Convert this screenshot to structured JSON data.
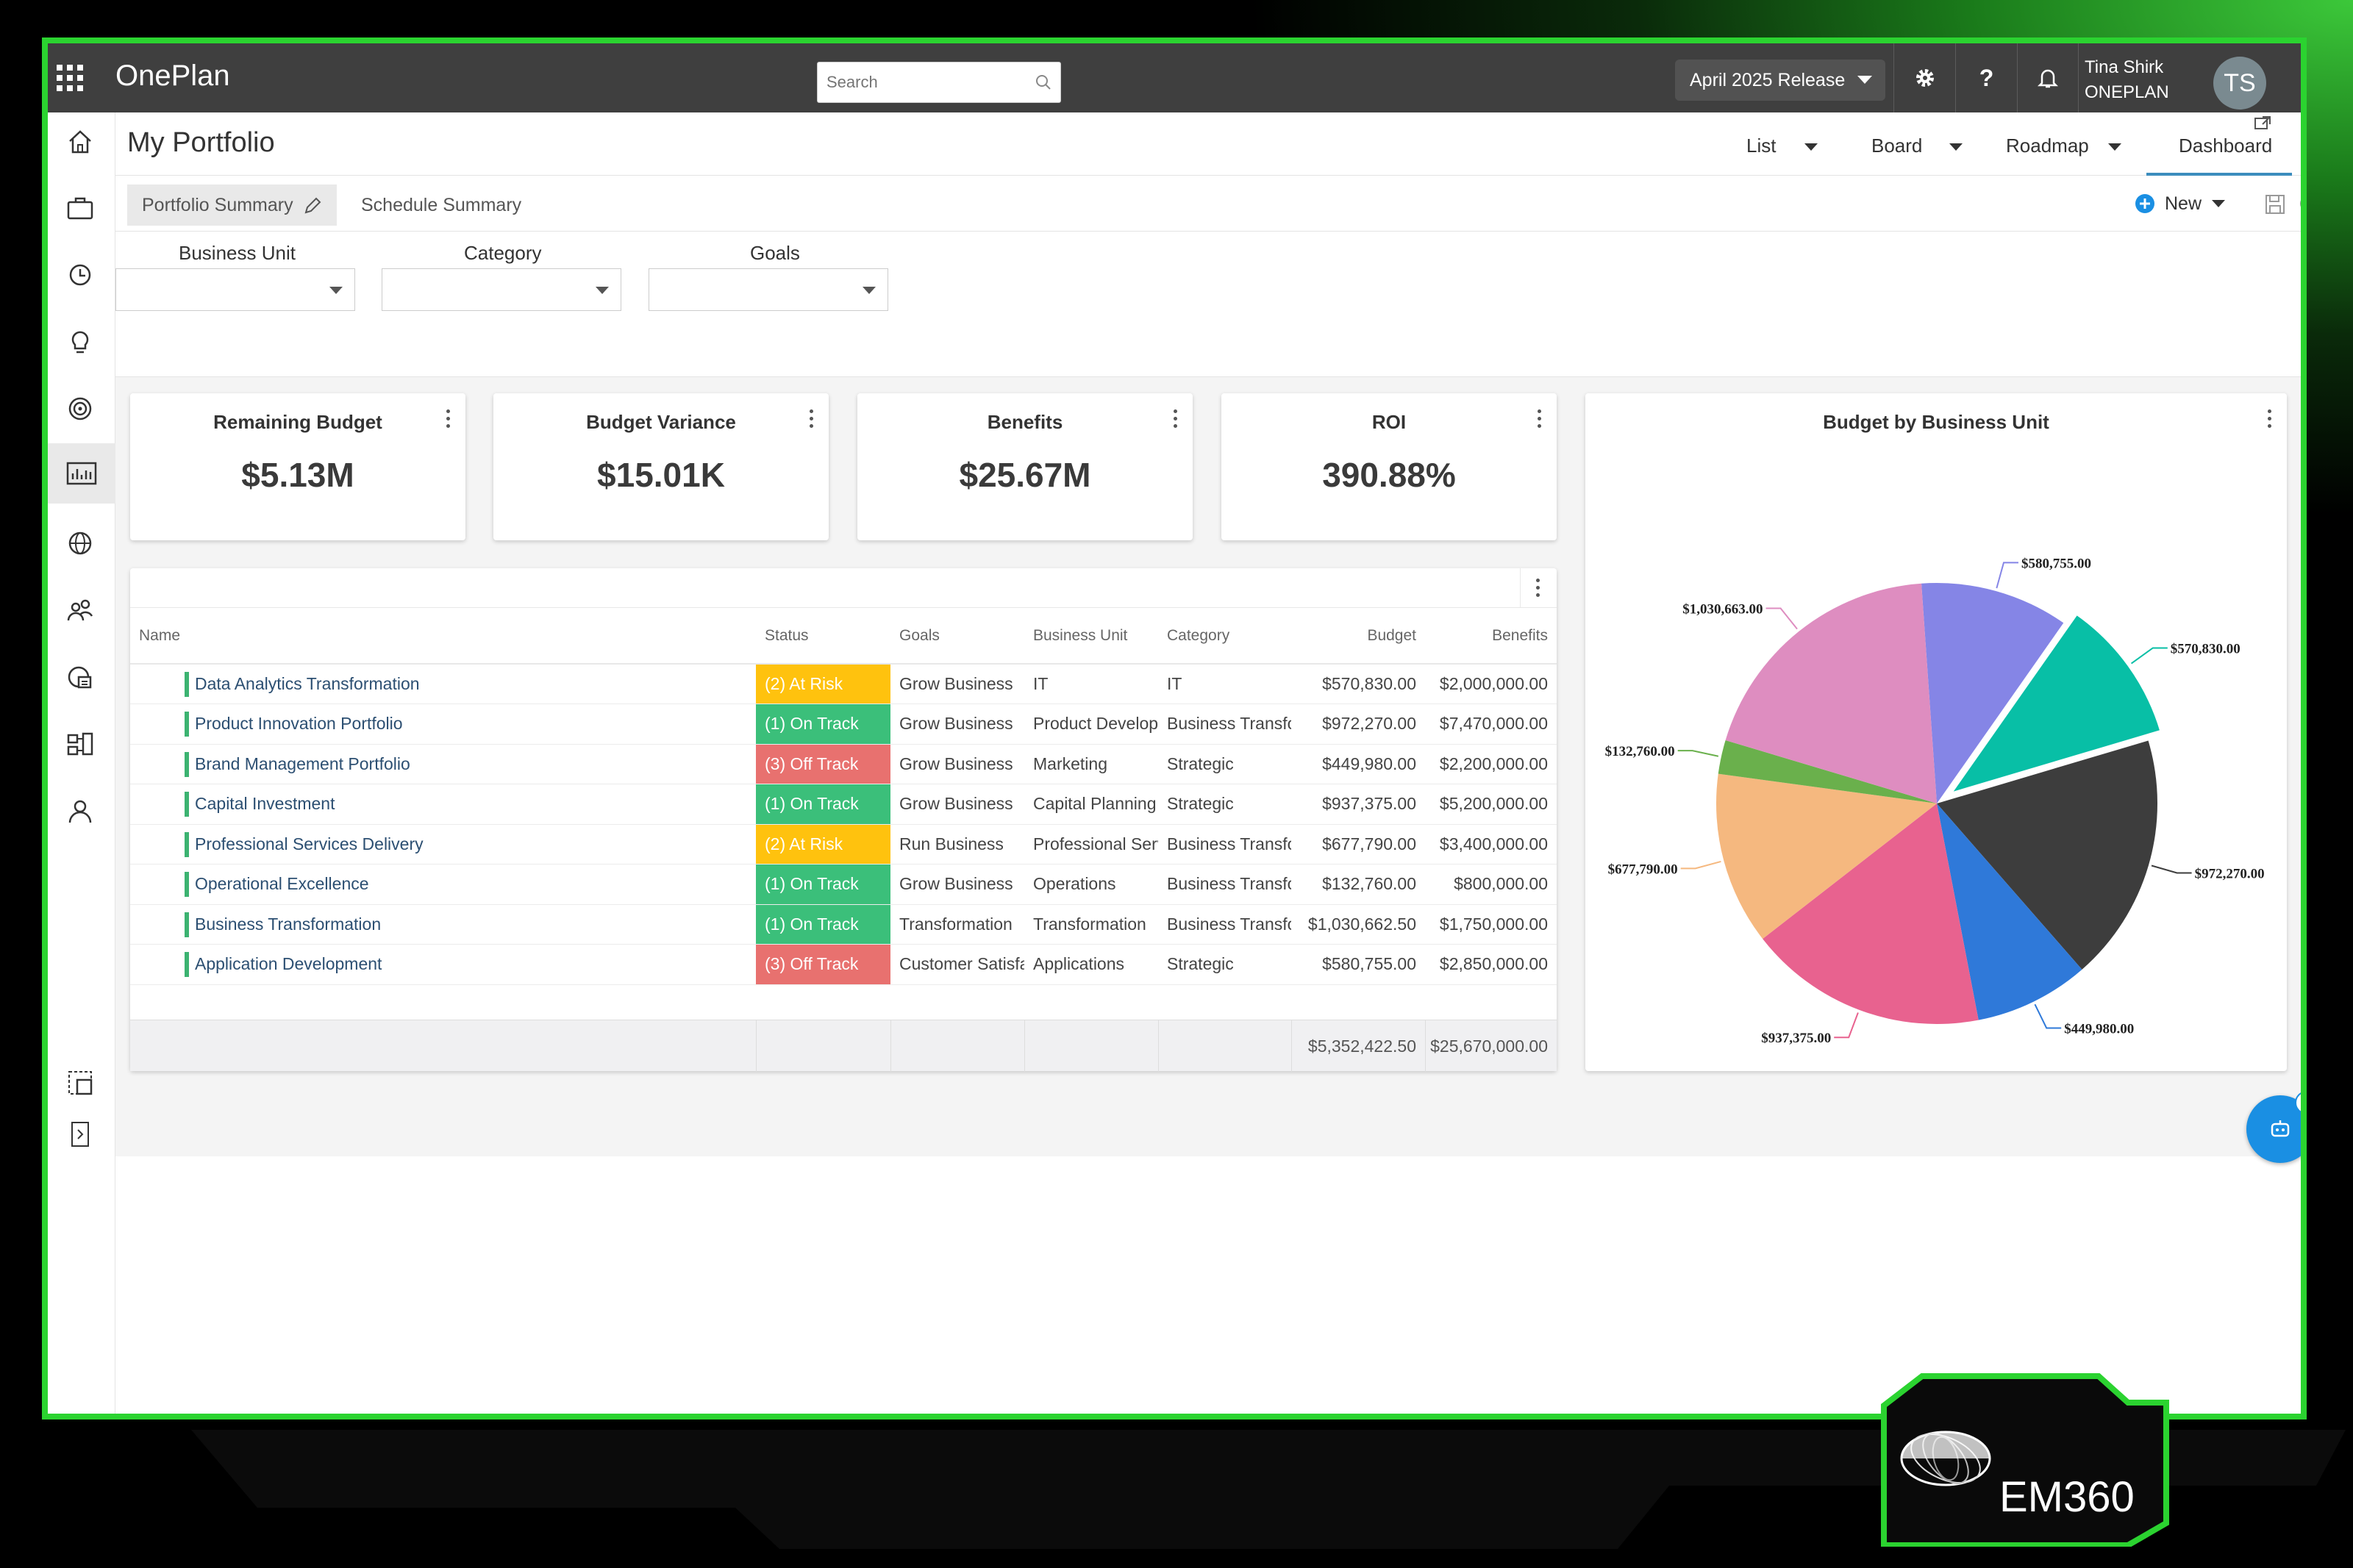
{
  "app": {
    "name": "OnePlan"
  },
  "search": {
    "placeholder": "Search"
  },
  "release": {
    "label": "April 2025 Release"
  },
  "topbar_buttons": {
    "help_label": "?"
  },
  "user": {
    "name": "Tina Shirk",
    "org": "ONEPLAN",
    "initials": "TS"
  },
  "page": {
    "title": "My Portfolio"
  },
  "views": [
    "List",
    "Board",
    "Roadmap",
    "Dashboard"
  ],
  "active_view": "Dashboard",
  "tabs": {
    "portfolio_summary": "Portfolio Summary",
    "schedule_summary": "Schedule Summary",
    "new_label": "New"
  },
  "filters": {
    "business_unit": "Business Unit",
    "category": "Category",
    "goals": "Goals"
  },
  "kpis": [
    {
      "title": "Remaining Budget",
      "value": "$5.13M"
    },
    {
      "title": "Budget Variance",
      "value": "$15.01K"
    },
    {
      "title": "Benefits",
      "value": "$25.67M"
    },
    {
      "title": "ROI",
      "value": "390.88%"
    }
  ],
  "table": {
    "columns": [
      "Name",
      "Status",
      "Goals",
      "Business Unit",
      "Category",
      "Budget",
      "Benefits"
    ],
    "rows": [
      {
        "name": "Data Analytics Transformation",
        "status": "(2) At Risk",
        "goals": "Grow Business",
        "unit": "IT",
        "category": "IT",
        "budget": "$570,830.00",
        "benefits": "$2,000,000.00"
      },
      {
        "name": "Product Innovation Portfolio",
        "status": "(1) On Track",
        "goals": "Grow Business",
        "unit": "Product Develop",
        "category": "Business Transfo",
        "budget": "$972,270.00",
        "benefits": "$7,470,000.00"
      },
      {
        "name": "Brand Management Portfolio",
        "status": "(3) Off Track",
        "goals": "Grow Business",
        "unit": "Marketing",
        "category": "Strategic",
        "budget": "$449,980.00",
        "benefits": "$2,200,000.00"
      },
      {
        "name": "Capital Investment",
        "status": "(1) On Track",
        "goals": "Grow Business",
        "unit": "Capital Planning",
        "category": "Strategic",
        "budget": "$937,375.00",
        "benefits": "$5,200,000.00"
      },
      {
        "name": "Professional Services Delivery",
        "status": "(2) At Risk",
        "goals": "Run Business",
        "unit": "Professional Serv",
        "category": "Business Transfo",
        "budget": "$677,790.00",
        "benefits": "$3,400,000.00"
      },
      {
        "name": "Operational Excellence",
        "status": "(1) On Track",
        "goals": "Grow Business",
        "unit": "Operations",
        "category": "Business Transfo",
        "budget": "$132,760.00",
        "benefits": "$800,000.00"
      },
      {
        "name": "Business Transformation",
        "status": "(1) On Track",
        "goals": "Transformation",
        "unit": "Transformation",
        "category": "Business Transfo",
        "budget": "$1,030,662.50",
        "benefits": "$1,750,000.00"
      },
      {
        "name": "Application Development",
        "status": "(3) Off Track",
        "goals": "Customer Satisfa",
        "unit": "Applications",
        "category": "Strategic",
        "budget": "$580,755.00",
        "benefits": "$2,850,000.00"
      }
    ],
    "totals": {
      "budget": "$5,352,422.50",
      "benefits": "$25,670,000.00"
    }
  },
  "status_colors": {
    "(2) At Risk": "#ffc20e",
    "(1) On Track": "#3bbf7a",
    "(3) Off Track": "#e8716f"
  },
  "chart_data": {
    "type": "pie",
    "title": "Budget by Business Unit",
    "slices": [
      {
        "value": 580755.0,
        "label": "$580,755.00",
        "color": "#8585e6"
      },
      {
        "value": 570830.0,
        "label": "$570,830.00",
        "color": "#08bfa6",
        "exploded": true
      },
      {
        "value": 972270.0,
        "label": "$972,270.00",
        "color": "#3d3d3d"
      },
      {
        "value": 449980.0,
        "label": "$449,980.00",
        "color": "#2f79d9"
      },
      {
        "value": 937375.0,
        "label": "$937,375.00",
        "color": "#e8628f"
      },
      {
        "value": 677790.0,
        "label": "$677,790.00",
        "color": "#f5b87f"
      },
      {
        "value": 132760.0,
        "label": "$132,760.00",
        "color": "#6ab04c"
      },
      {
        "value": 1030663.0,
        "label": "$1,030,663.00",
        "color": "#de8dc0"
      }
    ]
  },
  "branding": {
    "em360": "EM360"
  }
}
